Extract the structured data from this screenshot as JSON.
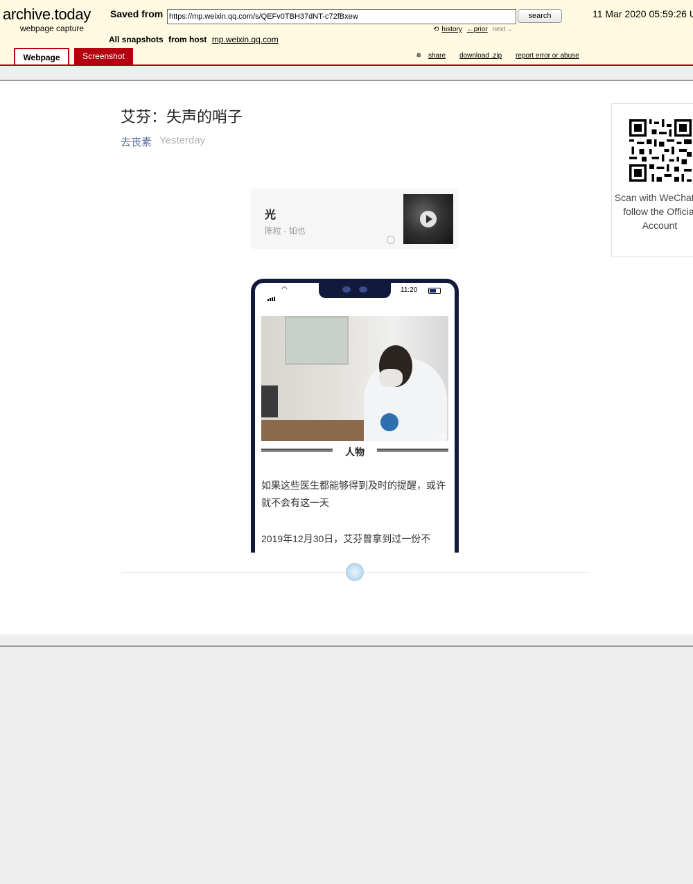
{
  "archive": {
    "logo": "archive.today",
    "logo_sub": "webpage capture",
    "saved_from_label": "Saved from",
    "url_value": "https://mp.weixin.qq.com/s/QEFv0TBH37dNT-c72fBxew",
    "search_label": "search",
    "datetime": "11 Mar 2020 05:59:26 U",
    "history_label": "history",
    "prior_label": "←prior",
    "next_label": "next→",
    "all_snapshots_label": "All snapshots",
    "from_host_label": "from host",
    "host": "mp.weixin.qq.com",
    "tab_webpage": "Webpage",
    "tab_screenshot": "Screenshot",
    "share_label": "share",
    "download_label": "download .zip",
    "report_label": "report error or abuse",
    "colors": {
      "header_bg": "#fffae1",
      "accent": "#b40010"
    }
  },
  "article": {
    "title": "艾芬：失声的哨子",
    "author": "去丧素",
    "time": "Yesterday",
    "music": {
      "title": "光",
      "artist": "陈粒 - 如也"
    },
    "phone": {
      "status_time": "11:20",
      "section_label": "人物",
      "watermark": "人物",
      "para1": "如果这些医生都能够得到及时的提醒，或许就不会有这一天",
      "para2": "2019年12月30日，艾芬曾拿到过一份不"
    },
    "qr_text": "Scan with WeChat to follow the Official Account",
    "colors": {
      "author": "#576b95",
      "time": "#b2b2b2",
      "phone_frame": "#121a3c"
    }
  }
}
